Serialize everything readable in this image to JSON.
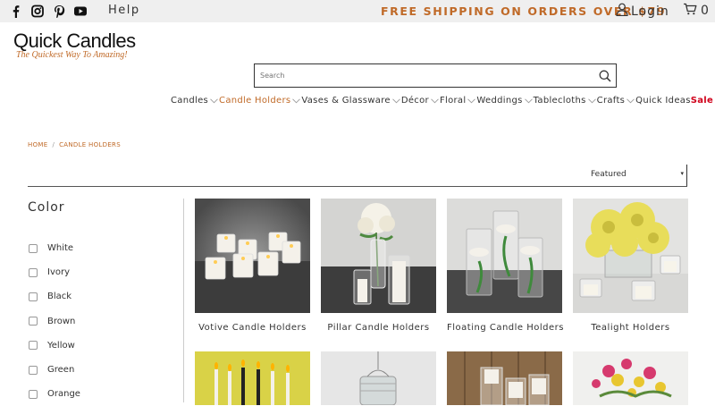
{
  "topbar": {
    "social_icons": [
      "facebook-icon",
      "instagram-icon",
      "pinterest-icon",
      "youtube-icon"
    ],
    "help_label": "Help",
    "shipping_text": "FREE SHIPPING ON ORDERS OVER $79",
    "login_label": "Login",
    "cart_count": "0"
  },
  "logo": {
    "name": "Quick Candles",
    "tagline": "The Quickest Way To Amazing!"
  },
  "search": {
    "placeholder": "Search"
  },
  "nav": {
    "items": [
      {
        "label": "Candles"
      },
      {
        "label": "Candle Holders"
      },
      {
        "label": "Vases & Glassware"
      },
      {
        "label": "Décor"
      },
      {
        "label": "Floral"
      },
      {
        "label": "Weddings"
      },
      {
        "label": "Tablecloths"
      },
      {
        "label": "Crafts"
      },
      {
        "label": "Quick Ideas"
      },
      {
        "label": "Sale"
      }
    ]
  },
  "breadcrumb": {
    "home": "HOME",
    "separator": "/",
    "current": "CANDLE HOLDERS"
  },
  "sort": {
    "selected": "Featured"
  },
  "filters": {
    "title": "Color",
    "options": [
      "White",
      "Ivory",
      "Black",
      "Brown",
      "Yellow",
      "Green",
      "Orange"
    ]
  },
  "products": [
    {
      "name": "Votive Candle Holders"
    },
    {
      "name": "Pillar Candle Holders"
    },
    {
      "name": "Floating Candle Holders"
    },
    {
      "name": "Tealight Holders"
    }
  ],
  "colors": {
    "accent": "#c06a28",
    "sale": "#d0021b",
    "topbar_bg": "#efefef"
  }
}
